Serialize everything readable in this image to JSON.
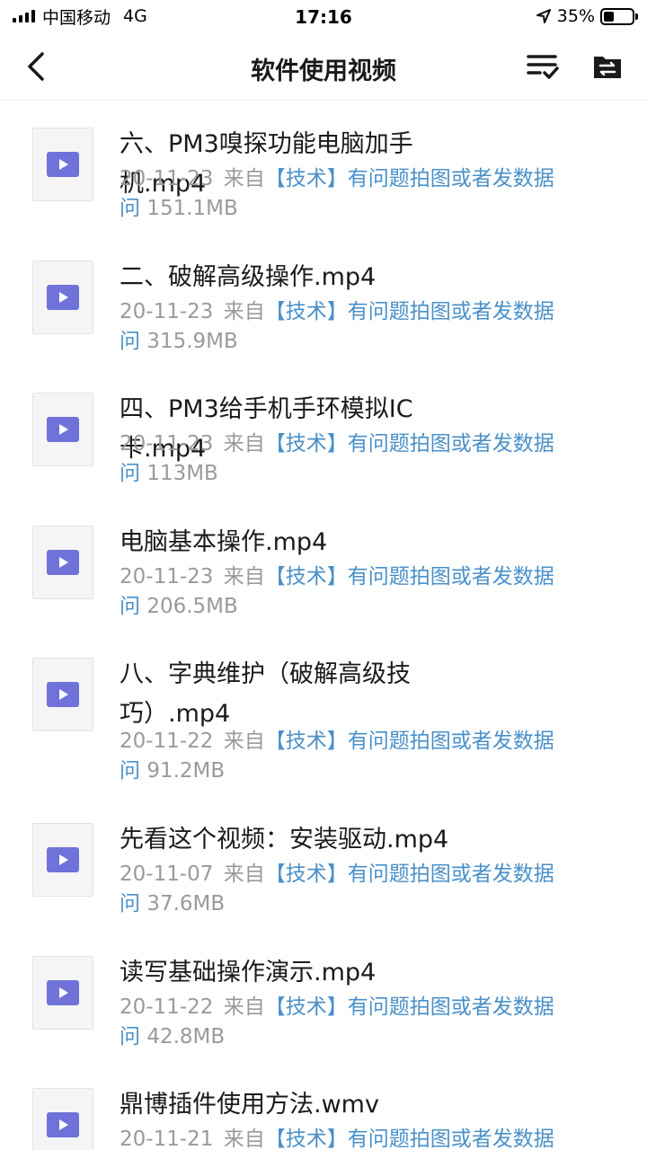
{
  "status_bar": {
    "carrier": "中国移动",
    "network": "4G",
    "time": "17:16",
    "battery_percent": "35%",
    "battery_level": 0.35,
    "icons": [
      "signal-icon",
      "location-icon",
      "battery-icon"
    ]
  },
  "nav": {
    "title": "软件使用视频",
    "icons": [
      "back-arrow-icon",
      "multi-select-icon",
      "folder-transfer-icon"
    ]
  },
  "colors": {
    "accent_blue": "#4a90c8",
    "play_icon": "#6f72d8",
    "meta_gray": "#9a9a9a"
  },
  "files": [
    {
      "name": "六、PM3嗅探功能电脑加手机.mp4",
      "date": "20-11-23",
      "from": "来自",
      "source": "【技术】有问题拍图或者发数据问",
      "size": "151.1MB"
    },
    {
      "name": "二、破解高级操作.mp4",
      "date": "20-11-23",
      "from": "来自",
      "source": "【技术】有问题拍图或者发数据问",
      "size": "315.9MB"
    },
    {
      "name": "四、PM3给手机手环模拟IC卡.mp4",
      "date": "20-11-23",
      "from": "来自",
      "source": "【技术】有问题拍图或者发数据问",
      "size": "113MB"
    },
    {
      "name": "电脑基本操作.mp4",
      "date": "20-11-23",
      "from": "来自",
      "source": "【技术】有问题拍图或者发数据问",
      "size": "206.5MB"
    },
    {
      "name": "八、字典维护（破解高级技巧）.mp4",
      "date": "20-11-22",
      "from": "来自",
      "source": "【技术】有问题拍图或者发数据问",
      "size": "91.2MB"
    },
    {
      "name": "先看这个视频：安装驱动.mp4",
      "date": "20-11-07",
      "from": "来自",
      "source": "【技术】有问题拍图或者发数据问",
      "size": "37.6MB"
    },
    {
      "name": "读写基础操作演示.mp4",
      "date": "20-11-22",
      "from": "来自",
      "source": "【技术】有问题拍图或者发数据问",
      "size": "42.8MB"
    },
    {
      "name": "鼎博插件使用方法.wmv",
      "date": "20-11-21",
      "from": "来自",
      "source": "【技术】有问题拍图或者发数据问",
      "size": ""
    }
  ]
}
